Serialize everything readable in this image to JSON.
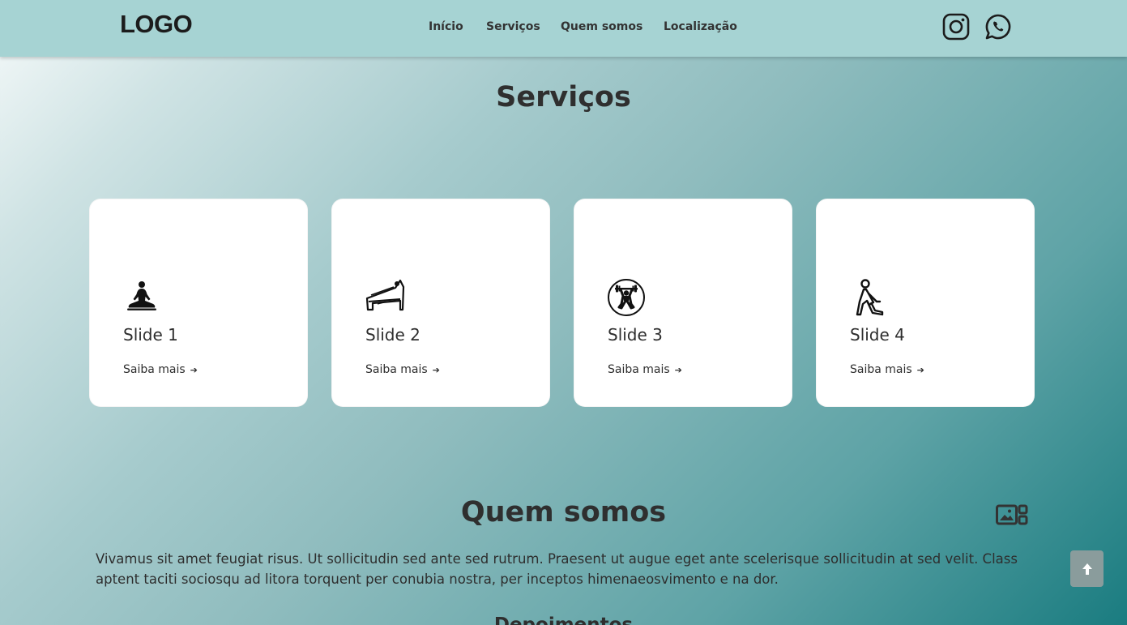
{
  "header": {
    "logo": "LOGO",
    "nav": [
      "Início",
      "Serviços",
      "Quem somos",
      "Localização"
    ],
    "social": [
      "instagram-icon",
      "whatsapp-icon"
    ]
  },
  "services": {
    "title": "Serviços",
    "cards": [
      {
        "title": "Slide 1",
        "link": "Saiba mais",
        "icon": "meditation-icon"
      },
      {
        "title": "Slide 2",
        "link": "Saiba mais",
        "icon": "pilates-reformer-icon"
      },
      {
        "title": "Slide 3",
        "link": "Saiba mais",
        "icon": "weightlifting-icon"
      },
      {
        "title": "Slide 4",
        "link": "Saiba mais",
        "icon": "stretching-icon"
      }
    ]
  },
  "about": {
    "title": "Quem somos",
    "text": "Vivamus sit amet feugiat risus. Ut sollicitudin sed ante sed rutrum. Praesent ut augue eget ante scelerisque sollicitudin at sed velit. Class aptent taciti sociosqu ad litora torquent per conubia nostra, per inceptos himenaeosvimento e na dor.",
    "subtitle": "Depoimentos"
  },
  "colors": {
    "header_bg": "#a6d3d3",
    "card_bg": "#ffffff",
    "text": "#333333",
    "scroll_button": "#8a9c9c"
  }
}
